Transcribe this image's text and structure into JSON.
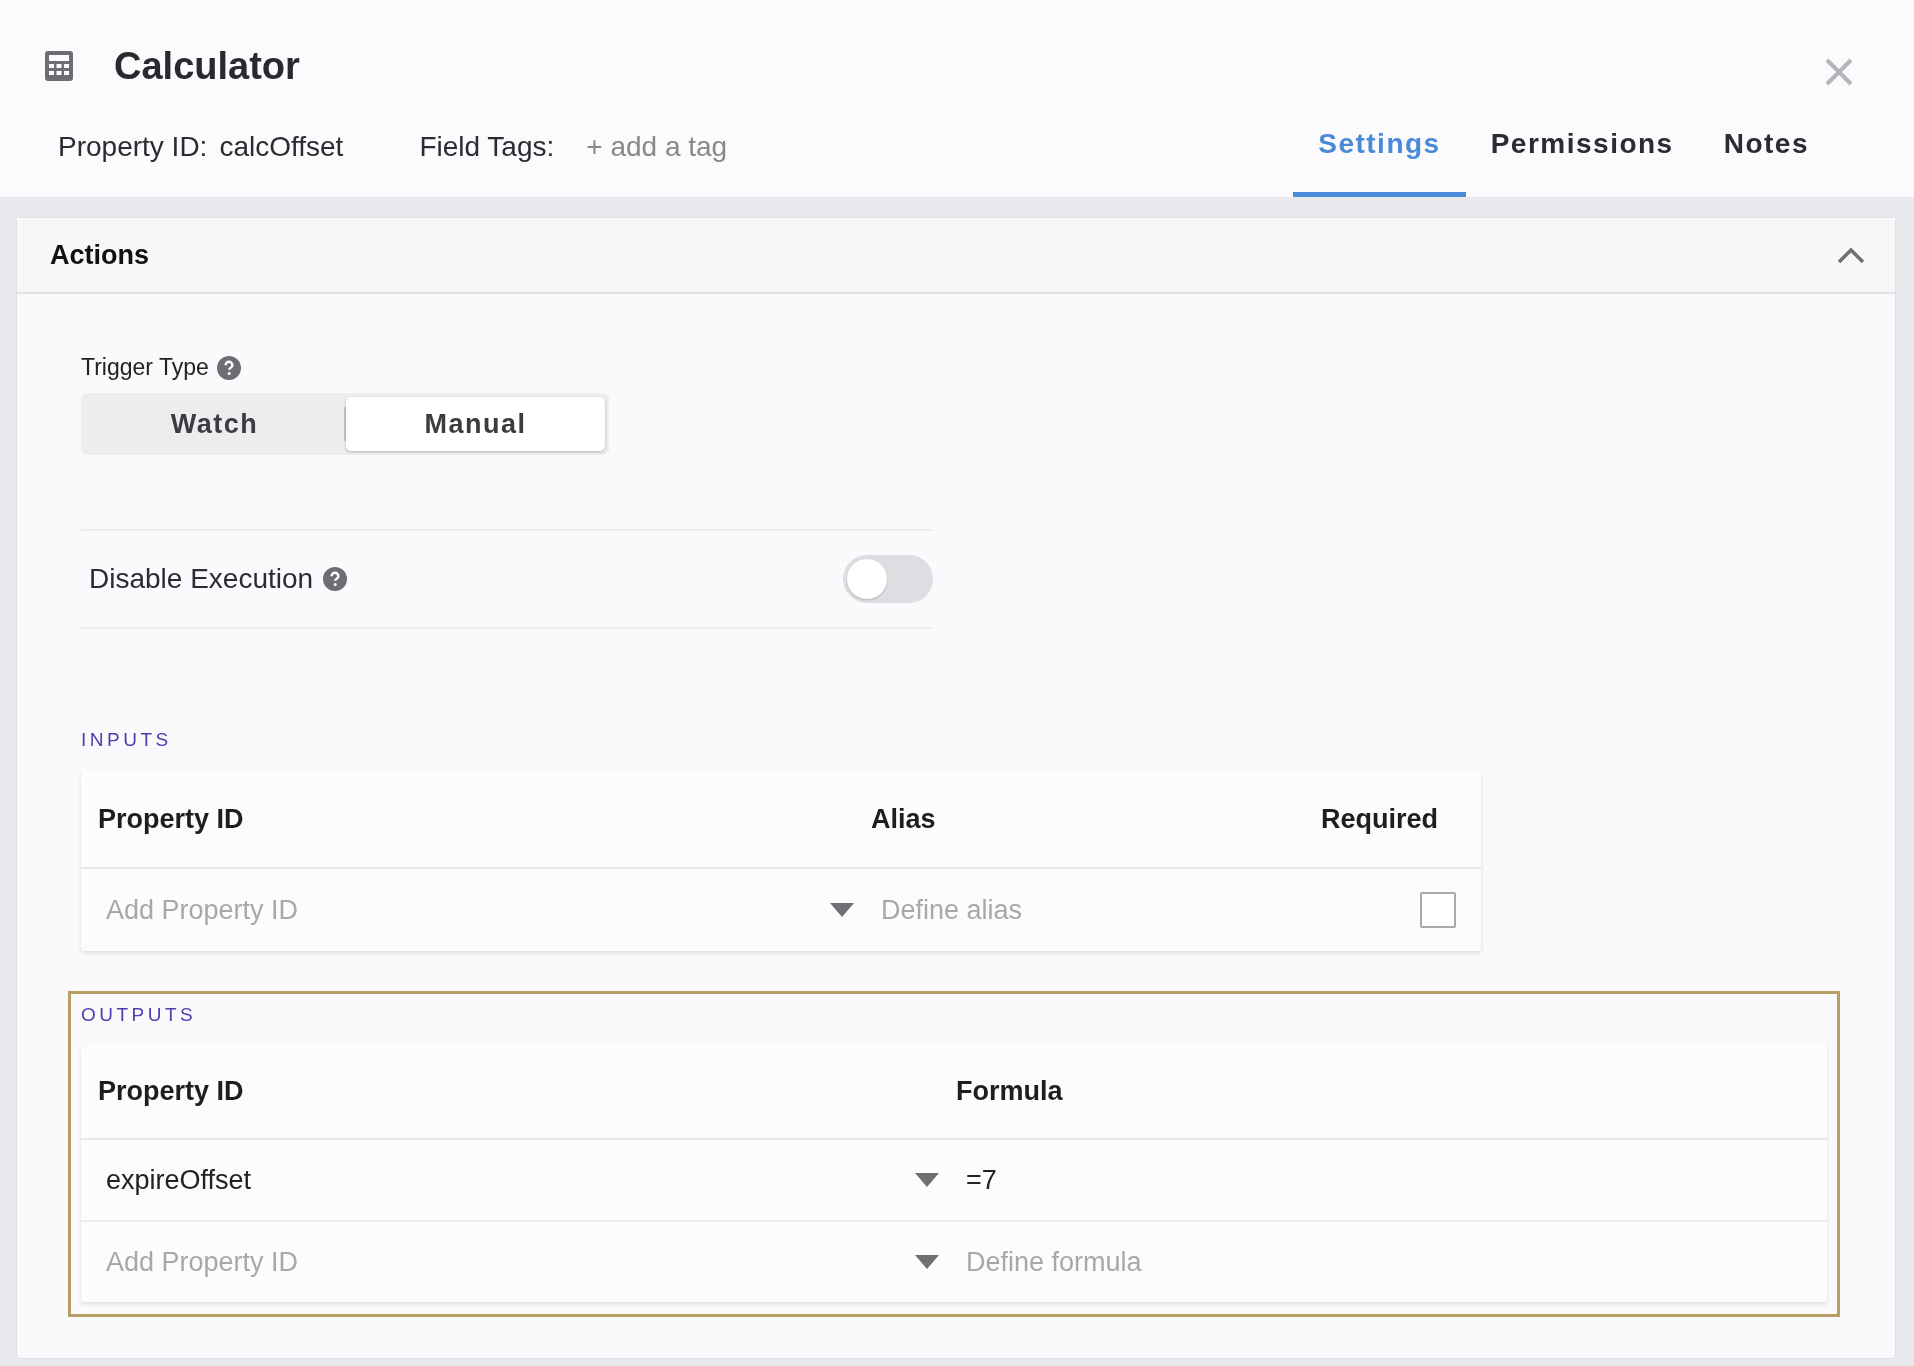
{
  "window": {
    "title": "Calculator"
  },
  "header": {
    "property_id_label": "Property ID:",
    "property_id": "calcOffset",
    "field_tags_label": "Field Tags:",
    "add_tag": "+ add a tag"
  },
  "tabs": [
    {
      "label": "Settings",
      "selected": true
    },
    {
      "label": "Permissions",
      "selected": false
    },
    {
      "label": "Notes",
      "selected": false
    }
  ],
  "panel": {
    "title": "Actions",
    "expanded": true
  },
  "trigger_type": {
    "label": "Trigger Type",
    "options": [
      {
        "label": "Watch",
        "selected": false
      },
      {
        "label": "Manual",
        "selected": true
      }
    ]
  },
  "disable_execution": {
    "label": "Disable Execution",
    "on": false
  },
  "inputs": {
    "title": "INPUTS",
    "columns": [
      "Property ID",
      "Alias",
      "Required"
    ],
    "rows": [
      {
        "property_id": {
          "placeholder": "Add Property ID"
        },
        "alias": {
          "placeholder": "Define alias"
        },
        "required": false
      }
    ]
  },
  "outputs": {
    "title": "OUTPUTS",
    "columns": [
      "Property ID",
      "Formula"
    ],
    "rows": [
      {
        "property_id": {
          "value": "expireOffset"
        },
        "formula": {
          "value": "=7"
        }
      },
      {
        "property_id": {
          "placeholder": "Add Property ID"
        },
        "formula": {
          "placeholder": "Define formula"
        }
      }
    ]
  }
}
